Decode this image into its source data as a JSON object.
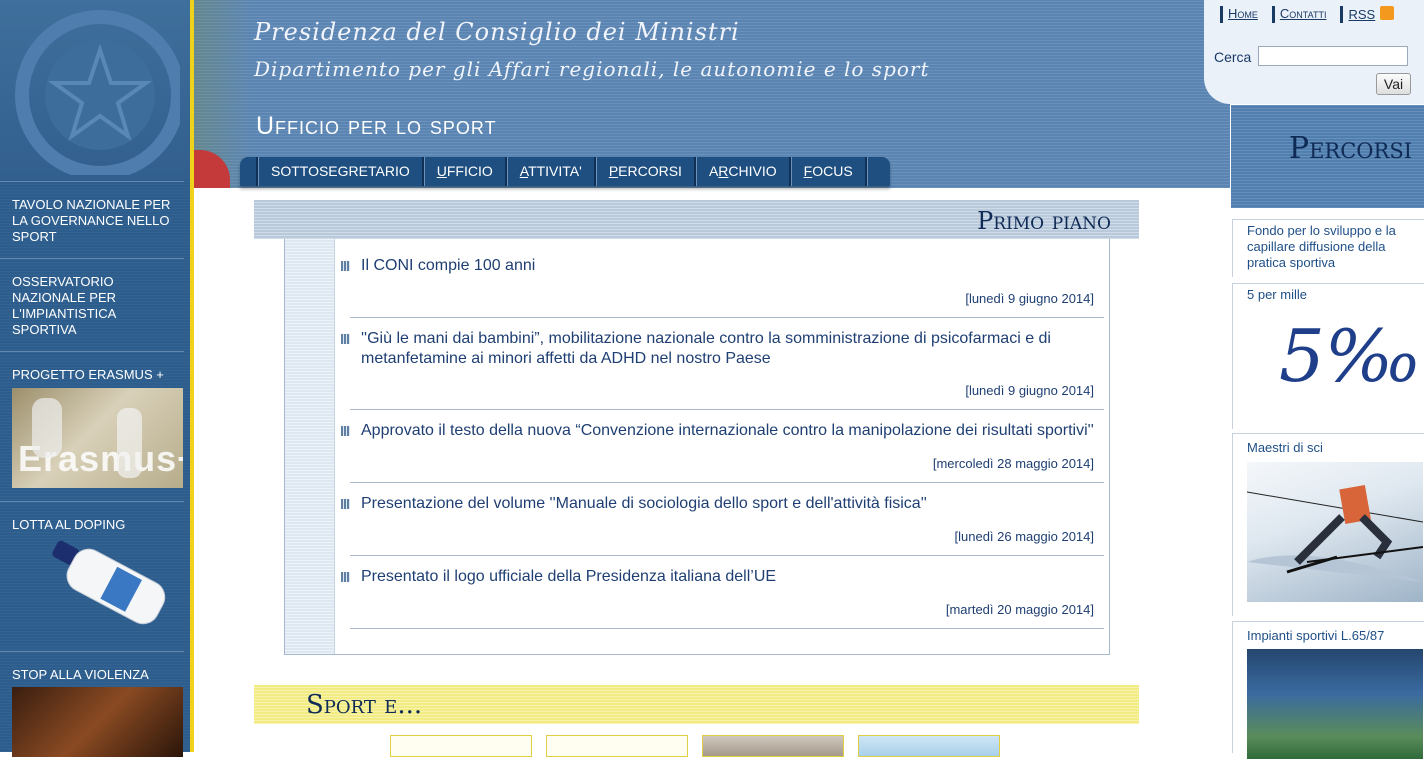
{
  "header": {
    "line1": "Presidenza del Consiglio dei Ministri",
    "line2": "Dipartimento per gli Affari regionali, le autonomie e lo sport",
    "office": "Ufficio per lo sport"
  },
  "nav": [
    {
      "first": "",
      "rest": "SOTTOSEGRETARIO"
    },
    {
      "first": "U",
      "rest": "FFICIO"
    },
    {
      "first": "A",
      "rest": "TTIVITA'"
    },
    {
      "first": "P",
      "rest": "ERCORSI"
    },
    {
      "first": "",
      "pre": "A",
      "u": "R",
      "rest": "CHIVIO"
    },
    {
      "first": "F",
      "rest": "OCUS"
    }
  ],
  "nav_labels": {
    "sottosegretario": "SOTTOSEGRETARIO",
    "ufficio_u": "U",
    "ufficio_rest": "FFICIO",
    "attivita_u": "A",
    "attivita_rest": "TTIVITA'",
    "percorsi_u": "P",
    "percorsi_rest": "ERCORSI",
    "archivio_pre": "A",
    "archivio_u": "R",
    "archivio_rest": "CHIVIO",
    "focus_u": "F",
    "focus_rest": "OCUS"
  },
  "top_links": {
    "home": "Home",
    "contatti": "Contatti",
    "rss": "RSS"
  },
  "search": {
    "label": "Cerca",
    "value": "",
    "button": "Vai"
  },
  "sidebar": {
    "items": [
      {
        "label": "TAVOLO NAZIONALE PER LA GOVERNANCE NELLO SPORT"
      },
      {
        "label": "OSSERVATORIO NAZIONALE PER L'IMPIANTISTICA SPORTIVA"
      },
      {
        "label": "PROGETTO ERASMUS +",
        "image_text": "Erasmus+"
      },
      {
        "label": "LOTTA AL DOPING"
      },
      {
        "label": "STOP ALLA VIOLENZA"
      }
    ]
  },
  "primo_piano": {
    "title": "Primo piano",
    "items": [
      {
        "title": "Il CONI compie 100 anni",
        "date": "[lunedì 9 giugno 2014]"
      },
      {
        "title": "''Giù le mani dai bambini”, mobilitazione nazionale contro la somministrazione di psicofarmaci e di metanfetamine ai minori affetti da ADHD nel nostro Paese",
        "date": "[lunedì 9 giugno 2014]"
      },
      {
        "title": "Approvato il testo della nuova “Convenzione internazionale contro la manipolazione dei risultati sportivi''",
        "date": "[mercoledì 28 maggio 2014]"
      },
      {
        "title": "Presentazione del volume ''Manuale di sociologia dello sport e dell'attività fisica''",
        "date": "[lunedì 26 maggio 2014]"
      },
      {
        "title": "Presentato il logo ufficiale della Presidenza italiana dell’UE",
        "date": "[martedì 20 maggio 2014]"
      }
    ]
  },
  "sport_e": {
    "title": "Sport e..."
  },
  "percorsi": {
    "title": "Percorsi",
    "items": [
      {
        "label": "Fondo per lo sviluppo e la capillare diffusione della pratica sportiva"
      },
      {
        "label": "5 per mille",
        "image_text": "5‰"
      },
      {
        "label": "Maestri di sci"
      },
      {
        "label": "Impianti sportivi L.65/87"
      }
    ]
  },
  "colors": {
    "sidebar": "#2c5d8d",
    "accent_yellow": "#f1d21a",
    "link": "#1f3f73"
  }
}
